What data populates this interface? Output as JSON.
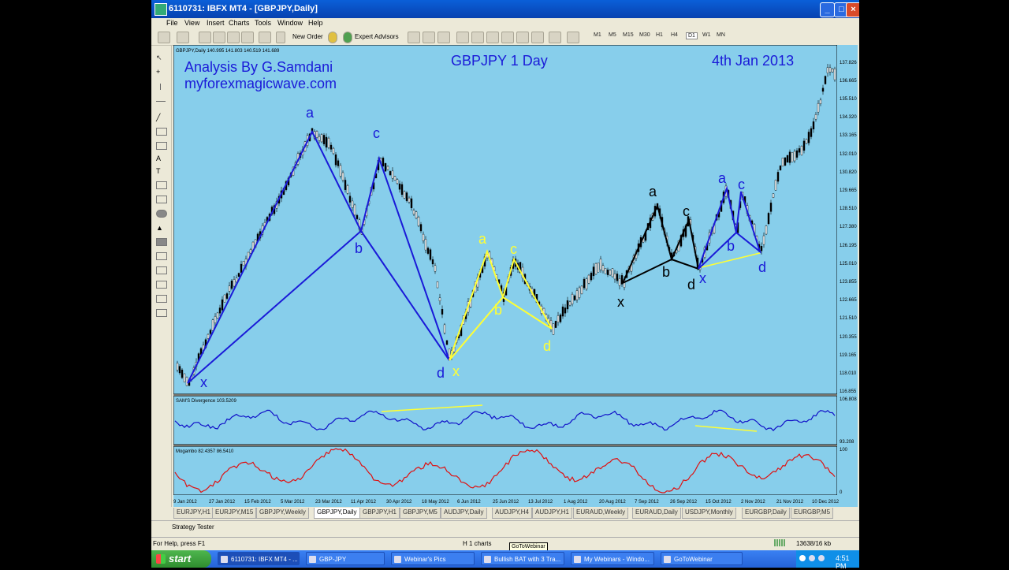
{
  "window": {
    "title": "6110731: IBFX MT4 - [GBPJPY,Daily]",
    "controls": [
      "_",
      "□",
      "×"
    ]
  },
  "menu": [
    "File",
    "View",
    "Insert",
    "Charts",
    "Tools",
    "Window",
    "Help"
  ],
  "toolbar": {
    "new_order": "New Order",
    "expert_advisors": "Expert Advisors",
    "timeframes": [
      "M1",
      "M5",
      "M15",
      "M30",
      "H1",
      "H4",
      "D1",
      "W1",
      "MN"
    ],
    "active_timeframe": "D1"
  },
  "chart": {
    "header": "GBPJPY,Daily  140.995 141.803 140.519 141.689",
    "title_left": "Analysis By G.Samdani",
    "website": "myforexmagicwave.com",
    "title_center": "GBPJPY 1 Day",
    "title_date": "4th Jan 2013",
    "bg_color": "#87ceeb",
    "candle_color": "#000000",
    "price_labels": [
      "137.826",
      "136.665",
      "135.510",
      "134.320",
      "133.165",
      "132.010",
      "130.820",
      "129.665",
      "128.510",
      "127.380",
      "126.195",
      "125.010",
      "123.855",
      "122.665",
      "121.510",
      "120.355",
      "119.165",
      "118.010",
      "116.855"
    ],
    "date_labels": [
      "9 Jan 2012",
      "27 Jan 2012",
      "15 Feb 2012",
      "5 Mar 2012",
      "23 Mar 2012",
      "11 Apr 2012",
      "30 Apr 2012",
      "18 May 2012",
      "6 Jun 2012",
      "25 Jun 2012",
      "13 Jul 2012",
      "1 Aug 2012",
      "20 Aug 2012",
      "7 Sep 2012",
      "26 Sep 2012",
      "15 Oct 2012",
      "2 Nov 2012",
      "21 Nov 2012",
      "10 Dec 2012"
    ],
    "pattern_labels": {
      "blue1": [
        "x",
        "a",
        "b",
        "c",
        "d"
      ],
      "yellow": [
        "x",
        "a",
        "b",
        "c",
        "d"
      ],
      "black": [
        "x",
        "a",
        "b",
        "c",
        "d"
      ],
      "blue2": [
        "x",
        "a",
        "b",
        "c",
        "d"
      ]
    },
    "colors": {
      "blue": "#1a1ad8",
      "yellow": "#ffff33",
      "black": "#000000"
    }
  },
  "indicator1": {
    "label": "SAM'S Divergence 103.5209",
    "scale_top": "106.808",
    "scale_bottom": "93.208",
    "line_color": "#1010c8",
    "div_color": "#ffff33"
  },
  "indicator2": {
    "label": "Mogambo 82.4357 86.5410",
    "scale_top": "100",
    "scale_bottom": "0",
    "line_color": "#e01010"
  },
  "tabs": [
    "EURJPY,H1",
    "EURJPY,M15",
    "GBPJPY,Weekly",
    "GBPJPY,Daily",
    "GBPJPY,H1",
    "GBPJPY,M5",
    "AUDJPY,Daily",
    "AUDJPY,H4",
    "AUDJPY,H1",
    "EURAUD,Weekly",
    "EURAUD,Daily",
    "USDJPY,Monthly",
    "EURGBP,Daily",
    "EURGBP,M5"
  ],
  "active_tab": "GBPJPY,Daily",
  "strategy_tester": "Strategy Tester",
  "status": {
    "help": "For Help, press F1",
    "charts": "H 1 charts",
    "traffic": "13638/16 kb"
  },
  "taskbar": {
    "start": "start",
    "items": [
      "6110731: IBFX MT4 - ...",
      "GBP-JPY",
      "Webinar's Pics",
      "Bullish BAT with 3 Tra...",
      "My Webinars - Windo...",
      "GoToWebinar"
    ],
    "active_item": "6110731: IBFX MT4 - ...",
    "tooltip": "GoToWebinar",
    "clock": "4:51 PM"
  }
}
